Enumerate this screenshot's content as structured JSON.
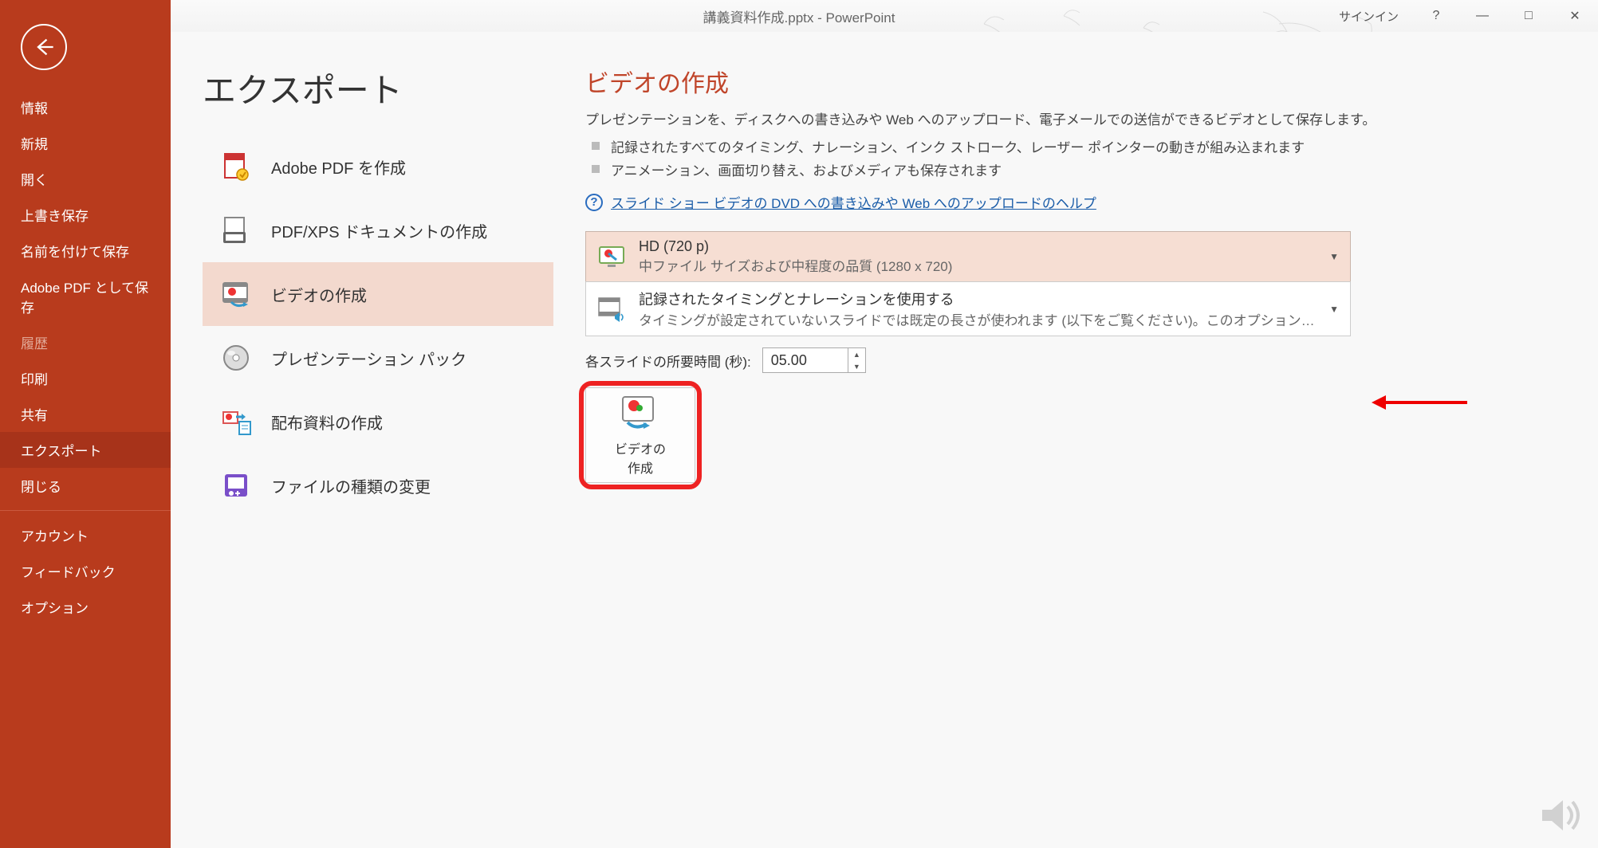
{
  "titlebar": {
    "title": "講義資料作成.pptx - PowerPoint",
    "signin": "サインイン",
    "help": "?",
    "min": "—",
    "max": "□",
    "close": "✕"
  },
  "sidebar": {
    "items": [
      "情報",
      "新規",
      "開く",
      "上書き保存",
      "名前を付けて保存",
      "Adobe PDF として保存",
      "履歴",
      "印刷",
      "共有",
      "エクスポート",
      "閉じる"
    ],
    "bottom": [
      "アカウント",
      "フィードバック",
      "オプション"
    ],
    "disabled_index": 6,
    "active_index": 9
  },
  "page": {
    "title": "エクスポート"
  },
  "export_options": [
    {
      "label": "Adobe PDF を作成"
    },
    {
      "label": "PDF/XPS ドキュメントの作成"
    },
    {
      "label": "ビデオの作成"
    },
    {
      "label": "プレゼンテーション パック"
    },
    {
      "label": "配布資料の作成"
    },
    {
      "label": "ファイルの種類の変更"
    }
  ],
  "export_active_index": 2,
  "video": {
    "heading": "ビデオの作成",
    "desc": "プレゼンテーションを、ディスクへの書き込みや Web へのアップロード、電子メールでの送信ができるビデオとして保存します。",
    "bullets": [
      "記録されたすべてのタイミング、ナレーション、インク ストローク、レーザー ポインターの動きが組み込まれます",
      "アニメーション、画面切り替え、およびメディアも保存されます"
    ],
    "help_link": "スライド ショー ビデオの DVD への書き込みや Web へのアップロードのヘルプ",
    "quality": {
      "title": "HD (720 p)",
      "sub": "中ファイル サイズおよび中程度の品質 (1280 x 720)"
    },
    "timing": {
      "title": "記録されたタイミングとナレーションを使用する",
      "sub": "タイミングが設定されていないスライドでは既定の長さが使われます (以下をご覧ください)。このオプション…"
    },
    "duration_label": "各スライドの所要時間 (秒):",
    "duration_value": "05.00",
    "create_btn_l1": "ビデオの",
    "create_btn_l2": "作成"
  }
}
